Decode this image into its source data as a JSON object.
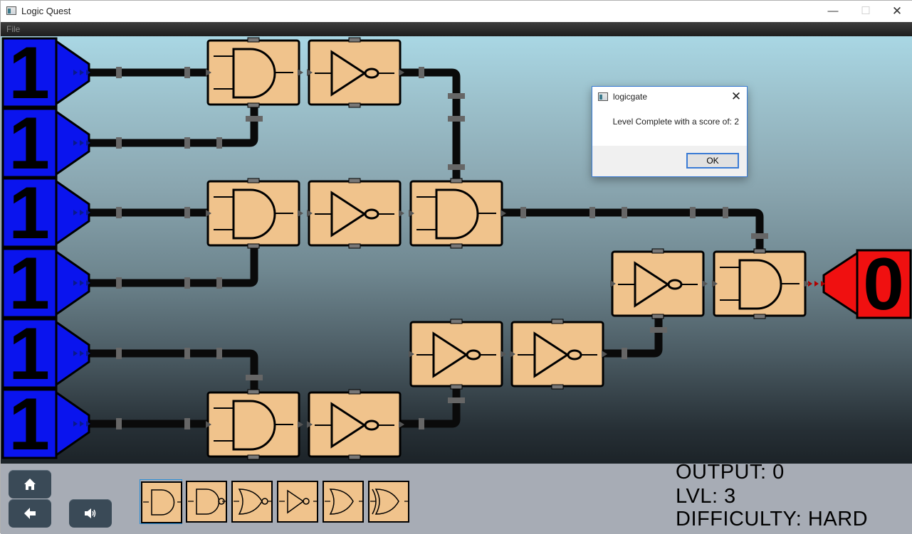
{
  "window": {
    "title": "Logic Quest",
    "controls": {
      "minimize": "—",
      "maximize": "☐",
      "close": "✕"
    }
  },
  "menu": {
    "file": "File"
  },
  "board": {
    "inputs": [
      "1",
      "1",
      "1",
      "1",
      "1",
      "1"
    ],
    "output": "0",
    "colors": {
      "input_fill": "#0a14ee",
      "output_fill": "#f01010",
      "gate_fill": "#f0c38c",
      "wire": "#0a0a0a",
      "joint": "#666666"
    },
    "gates": [
      {
        "name": "gate-and-1",
        "type": "AND"
      },
      {
        "name": "gate-not-1",
        "type": "NOT"
      },
      {
        "name": "gate-and-2",
        "type": "AND"
      },
      {
        "name": "gate-not-2",
        "type": "NOT"
      },
      {
        "name": "gate-and-3",
        "type": "AND"
      },
      {
        "name": "gate-not-3",
        "type": "NOT"
      },
      {
        "name": "gate-not-4",
        "type": "NOT"
      },
      {
        "name": "gate-and-4",
        "type": "AND"
      },
      {
        "name": "gate-not-5",
        "type": "NOT"
      },
      {
        "name": "gate-not-6",
        "type": "NOT"
      },
      {
        "name": "gate-and-5",
        "type": "AND"
      }
    ]
  },
  "toolbar": {
    "home_icon": "home-icon",
    "back_icon": "arrow-left-icon",
    "sound_icon": "speaker-icon",
    "palette": [
      {
        "type": "AND",
        "icon": "and-gate-icon",
        "selected": true
      },
      {
        "type": "NAND",
        "icon": "nand-gate-icon",
        "selected": false
      },
      {
        "type": "NOR",
        "icon": "nor-gate-icon",
        "selected": false
      },
      {
        "type": "NOT",
        "icon": "not-gate-icon",
        "selected": false
      },
      {
        "type": "OR",
        "icon": "or-gate-icon",
        "selected": false
      },
      {
        "type": "XOR",
        "icon": "xor-gate-icon",
        "selected": false
      }
    ]
  },
  "stats": {
    "output": "OUTPUT: 0",
    "level": "LVL: 3",
    "difficulty": "DIFFICULTY: HARD"
  },
  "dialog": {
    "title": "logicgate",
    "message": "Level Complete with a score of: 2",
    "ok": "OK",
    "close": "✕"
  }
}
